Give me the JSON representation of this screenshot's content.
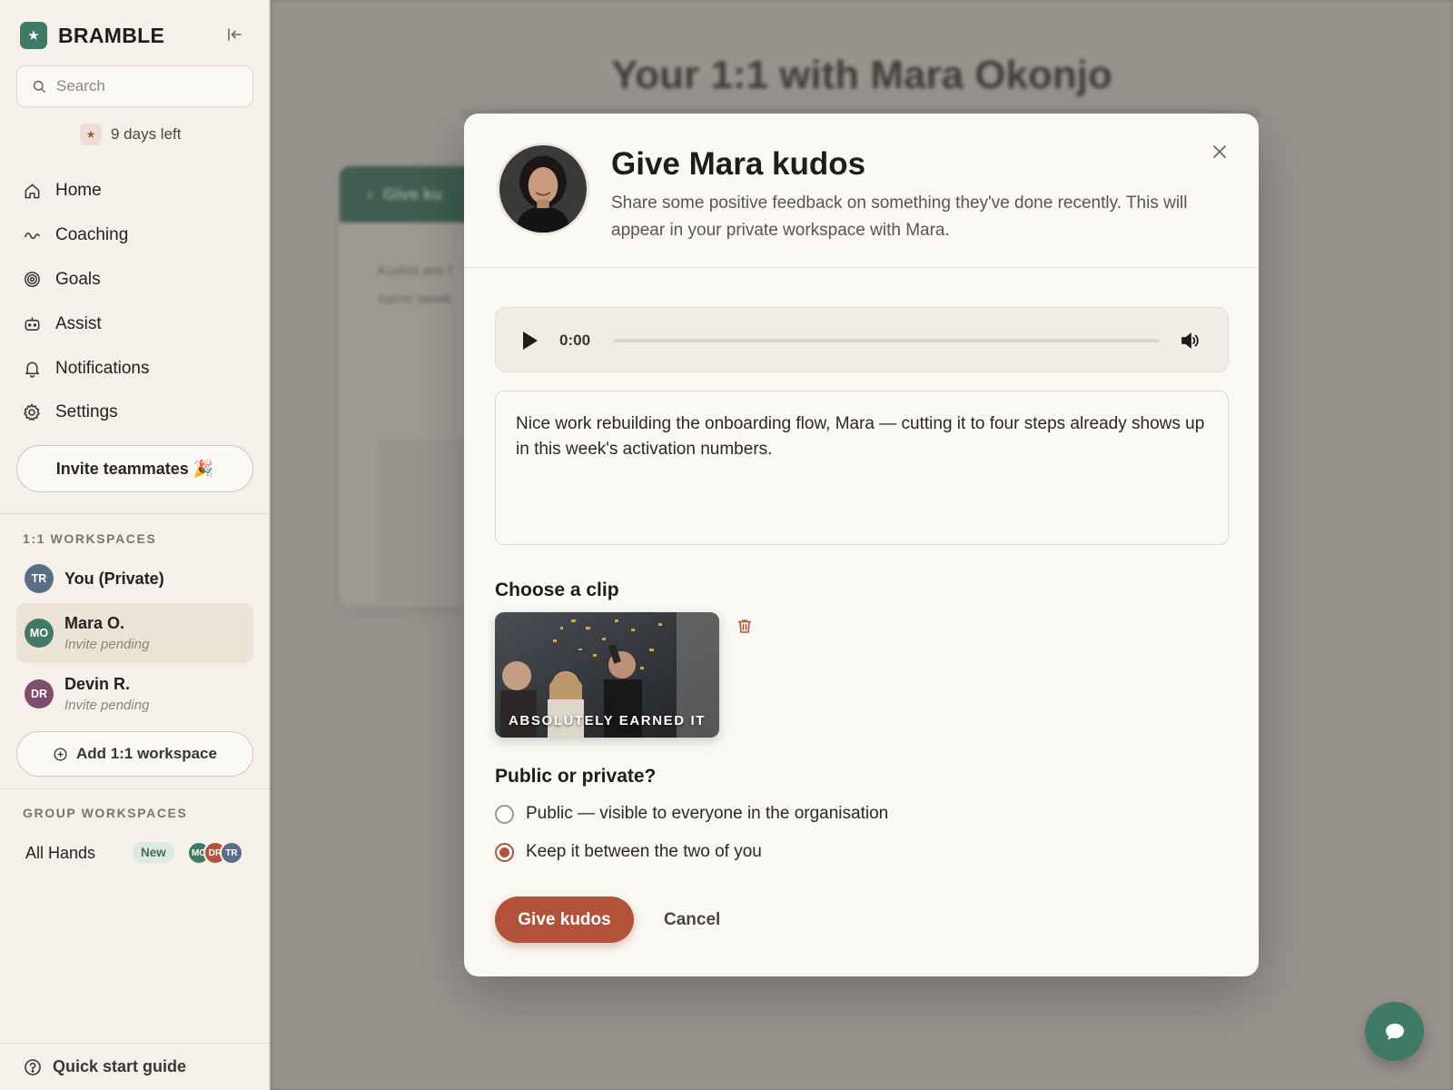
{
  "brand": {
    "name": "BRAMBLE",
    "logo_icon": "star-icon"
  },
  "search": {
    "placeholder": "Search"
  },
  "trial": {
    "text": "9 days left"
  },
  "nav": [
    {
      "label": "Home",
      "icon": "home-icon"
    },
    {
      "label": "Coaching",
      "icon": "coaching-icon"
    },
    {
      "label": "Goals",
      "icon": "target-icon"
    },
    {
      "label": "Assist",
      "icon": "bot-icon"
    },
    {
      "label": "Notifications",
      "icon": "bell-icon"
    },
    {
      "label": "Settings",
      "icon": "gear-icon"
    }
  ],
  "invite": {
    "label": "Invite teammates 🎉"
  },
  "one_on_one": {
    "heading": "1:1 WORKSPACES",
    "items": [
      {
        "initials": "TR",
        "name": "You (Private)",
        "sub": "",
        "color": "#5a6f86"
      },
      {
        "initials": "MO",
        "name": "Mara O.",
        "sub": "Invite pending",
        "color": "#3f7a67"
      },
      {
        "initials": "DR",
        "name": "Devin R.",
        "sub": "Invite pending",
        "color": "#7d4e6e"
      }
    ],
    "add_label": "Add 1:1 workspace"
  },
  "group": {
    "heading": "GROUP WORKSPACES",
    "item": {
      "name": "All Hands",
      "badge": "New",
      "members": [
        "MO",
        "DR",
        "TR"
      ]
    }
  },
  "quickstart": {
    "label": "Quick start guide"
  },
  "background": {
    "title": "Your 1:1 with Mara Okonjo",
    "card_header": "Give ku",
    "card_text_1": "Kudos are l",
    "card_text_2": "same week"
  },
  "modal": {
    "title": "Give Mara kudos",
    "description": "Share some positive feedback on something they've done recently. This will appear in your private workspace with Mara.",
    "audio": {
      "time": "0:00",
      "progress": 0
    },
    "message": "Nice work rebuilding the onboarding flow, Mara — cutting it to four steps already shows up in this week's activation numbers.",
    "clip_heading": "Choose a clip",
    "clip_caption": "ABSOLUTELY EARNED IT",
    "visibility_heading": "Public or private?",
    "options": [
      {
        "label": "Public — visible to everyone in the organisation",
        "checked": false
      },
      {
        "label": "Keep it between the two of you",
        "checked": true
      }
    ],
    "submit_label": "Give kudos",
    "cancel_label": "Cancel"
  },
  "colors": {
    "accent": "#b2523a",
    "brand": "#3f7a67",
    "surface": "#faf8f4"
  }
}
